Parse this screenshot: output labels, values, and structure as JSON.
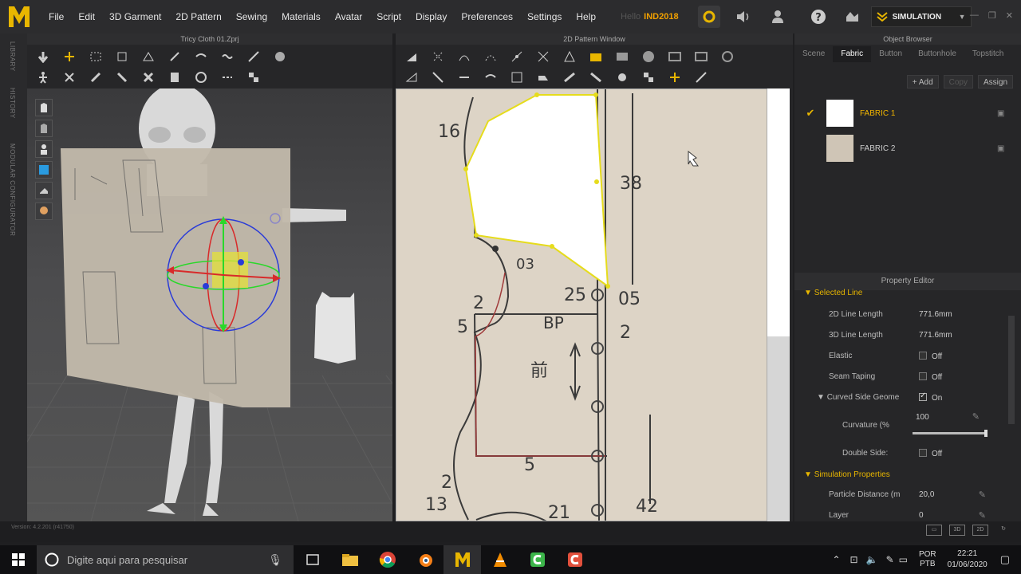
{
  "app": {
    "menu": [
      "File",
      "Edit",
      "3D Garment",
      "2D Pattern",
      "Sewing",
      "Materials",
      "Avatar",
      "Script",
      "Display",
      "Preferences",
      "Settings",
      "Help"
    ],
    "greeting": "Hello",
    "username": "IND2018",
    "simulation_label": "SIMULATION",
    "version": "Version: 4.2.201 (r41750)",
    "accent_color": "#e8b600"
  },
  "left_strip": {
    "tabs": [
      "LIBRARY",
      "HISTORY",
      "MODULAR CONFIGURATOR"
    ]
  },
  "window3d": {
    "title": "Tricy Cloth 01.Zprj"
  },
  "window2d": {
    "title": "2D Pattern Window",
    "labels": [
      "16",
      "38",
      "03",
      "25",
      "05",
      "2",
      "5",
      "BP",
      "2",
      "前",
      "5",
      "2",
      "13",
      "21",
      "42"
    ]
  },
  "object_browser": {
    "title": "Object Browser",
    "tabs": [
      "Scene",
      "Fabric",
      "Button",
      "Buttonhole",
      "Topstitch"
    ],
    "active_tab": "Fabric",
    "actions": {
      "add": "+ Add",
      "copy": "Copy",
      "assign": "Assign"
    },
    "fabrics": [
      {
        "name": "FABRIC 1",
        "selected": true
      },
      {
        "name": "FABRIC 2",
        "selected": false
      }
    ]
  },
  "property_editor": {
    "title": "Property Editor",
    "selected_line": "Selected Line",
    "line_2d_length_label": "2D Line Length",
    "line_2d_length_value": "771.6mm",
    "line_3d_length_label": "3D Line Length",
    "line_3d_length_value": "771.6mm",
    "elastic_label": "Elastic",
    "elastic_value": "Off",
    "seam_taping_label": "Seam Taping",
    "seam_taping_value": "Off",
    "curved_label": "Curved Side Geome",
    "curved_value": "On",
    "curvature_label": "Curvature (%",
    "curvature_value": "100",
    "double_side_label": "Double Side:",
    "double_side_value": "Off",
    "simulation_props": "Simulation Properties",
    "particle_label": "Particle Distance (m",
    "particle_value": "20,0",
    "layer_label": "Layer",
    "layer_value": "0"
  },
  "taskbar": {
    "search_placeholder": "Digite aqui para pesquisar",
    "lang_1": "POR",
    "lang_2": "PTB",
    "time": "22:21",
    "date": "01/06/2020"
  }
}
